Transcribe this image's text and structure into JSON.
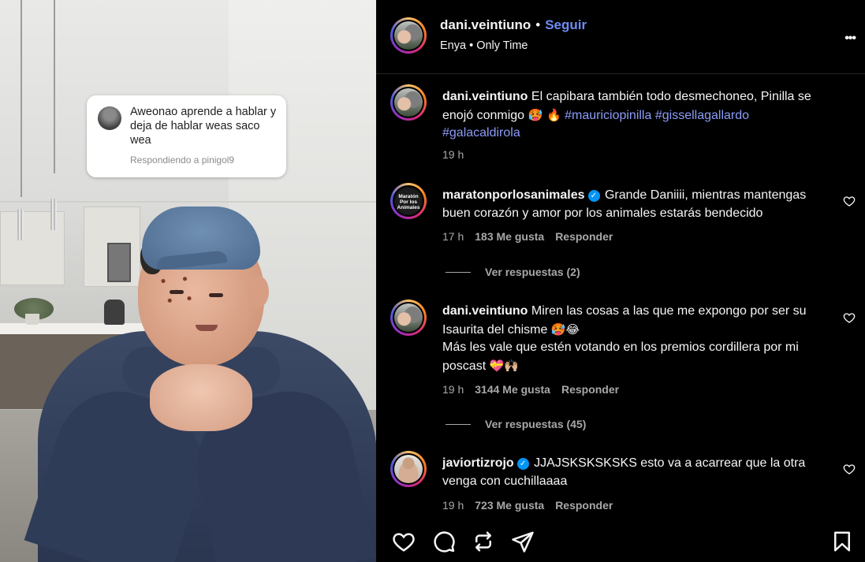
{
  "reply_sticker": {
    "text": "Aweonao aprende a hablar y deja de hablar weas saco wea",
    "subtitle": "Respondiendo a pinigol9"
  },
  "header": {
    "username": "dani.veintiuno",
    "separator": "•",
    "follow_label": "Seguir",
    "music_artist": "Enya",
    "music_separator": "•",
    "music_title": "Only Time",
    "more_label": "•••"
  },
  "caption": {
    "username": "dani.veintiuno",
    "text": "El capibara también todo desmechoneo, Pinilla se enojó conmigo",
    "emojis": "🥵 🔥",
    "hashtags": [
      "#mauriciopinilla",
      "#gissellagallardo",
      "#galacaldirola"
    ],
    "time": "19 h"
  },
  "comments": [
    {
      "username": "maratonporlosanimales",
      "verified": true,
      "text": "Grande Daniiii, mientras mantengas buen corazón y amor por los animales estarás bendecido",
      "time": "17 h",
      "likes": "183 Me gusta",
      "reply_label": "Responder",
      "view_replies": "Ver respuestas (2)"
    },
    {
      "username": "dani.veintiuno",
      "verified": false,
      "text": "Miren las cosas a las que me expongo por ser su Isaurita del chisme",
      "emojis1": "🥵😂",
      "text2": "Más les vale que estén votando en los premios cordillera por mi poscast",
      "emojis2": "💝🙌🏼",
      "time": "19 h",
      "likes": "3144 Me gusta",
      "reply_label": "Responder",
      "view_replies": "Ver respuestas (45)"
    },
    {
      "username": "javiortizrojo",
      "verified": true,
      "text": "JJAJSKSKSKSKS esto va a acarrear que la otra venga con cuchillaaaa",
      "time": "19 h",
      "likes": "723 Me gusta",
      "reply_label": "Responder"
    }
  ],
  "maraton_avatar_text": {
    "line1": "Maratón",
    "line2": "Por los",
    "line3": "Animales"
  },
  "colors": {
    "accent_link": "#6f8cf5",
    "hashtag": "#8c9cf7",
    "verified": "#0095f6",
    "background": "#000000"
  },
  "icons": [
    "heart-icon",
    "comment-icon",
    "repost-icon",
    "share-icon",
    "bookmark-icon",
    "more-icon"
  ]
}
